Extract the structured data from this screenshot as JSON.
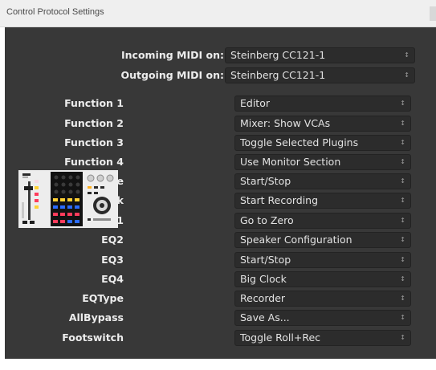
{
  "window": {
    "title": "Control Protocol Settings"
  },
  "midi": {
    "incoming": {
      "label": "Incoming MIDI on:",
      "value": "Steinberg CC121-1"
    },
    "outgoing": {
      "label": "Outgoing MIDI on:",
      "value": "Steinberg CC121-1"
    }
  },
  "functions": [
    {
      "label": "Function 1",
      "value": "Editor"
    },
    {
      "label": "Function 2",
      "value": "Mixer: Show VCAs"
    },
    {
      "label": "Function 3",
      "value": "Toggle Selected Plugins"
    },
    {
      "label": "Function 4",
      "value": "Use Monitor Section"
    },
    {
      "label": "Value",
      "value": "Start/Stop"
    },
    {
      "label": "Lock",
      "value": "Start Recording"
    },
    {
      "label": "EQ1",
      "value": "Go to Zero"
    },
    {
      "label": "EQ2",
      "value": "Speaker Configuration"
    },
    {
      "label": "EQ3",
      "value": "Start/Stop"
    },
    {
      "label": "EQ4",
      "value": "Big Clock"
    },
    {
      "label": "EQType",
      "value": "Recorder"
    },
    {
      "label": "AllBypass",
      "value": "Save As..."
    },
    {
      "label": "Footswitch",
      "value": "Toggle Roll+Rec"
    }
  ],
  "icons": {
    "combo_arrow": "updown-chevron-icon",
    "device": "steinberg-cc121-controller-image"
  },
  "colors": {
    "panel": "#383838",
    "text": "#ececec",
    "combo_bg": "#2c2c2c",
    "titlebar": "#efefef"
  }
}
